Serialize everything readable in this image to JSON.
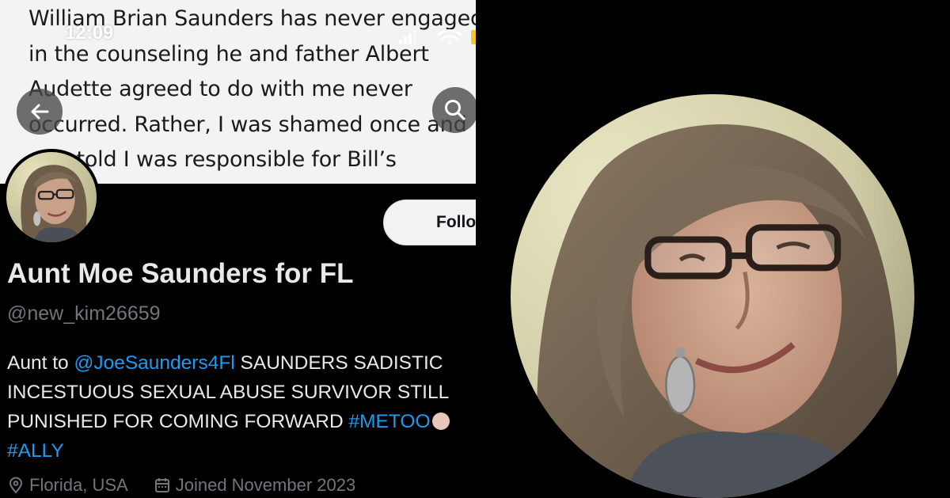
{
  "status_bar": {
    "time": "12:09"
  },
  "banner": {
    "lines": [
      "William Brian Saunders has never engaged",
      "in the counseling he and father Albert",
      "Audette agreed to do with me never",
      "occurred. Rather, I was shamed once and",
      "was told I was responsible for Bill’s"
    ]
  },
  "profile": {
    "follow_label": "Follow",
    "display_name": "Aunt Moe Saunders for FL",
    "handle": "@new_kim26659",
    "bio": {
      "prefix": "Aunt to ",
      "mention": "@JoeSaunders4Fl",
      "text1": " SAUNDERS SADISTIC",
      "line2": "INCESTUOUS SEXUAL ABUSE SURVIVOR STILL",
      "line3": "PUNISHED FOR COMING FORWARD ",
      "hashtag1": "#METOO",
      "hashtag2": "#ALLY"
    },
    "location": "Florida, USA",
    "joined": "Joined November 2023"
  },
  "icons": {
    "back": "arrow-left-icon",
    "search": "search-icon",
    "location": "location-pin-icon",
    "calendar": "calendar-icon"
  },
  "colors": {
    "link": "#1d9bf0",
    "secondary_text": "#71767b",
    "primary_text": "#e7e9ea",
    "background": "#000000"
  }
}
